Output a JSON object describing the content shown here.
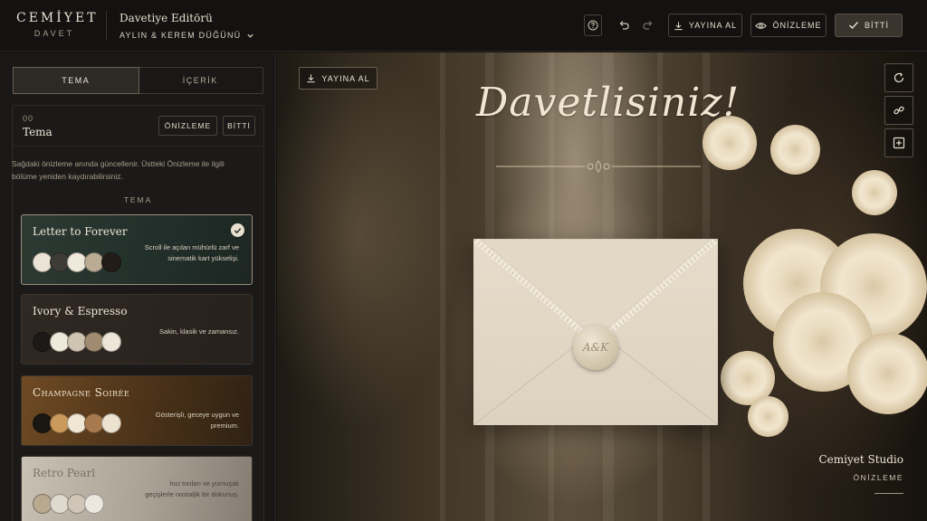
{
  "header": {
    "brand_name": "CEMİYET",
    "brand_sub": "DAVET",
    "title": "Davetiye Editörü",
    "subtitle": "AYLIN & KEREM DÜĞÜNÜ",
    "publish_label": "YAYINA AL",
    "preview_label": "ÖNİZLEME",
    "done_label": "BİTTİ"
  },
  "tabs": [
    {
      "label": "TEMA",
      "active": true
    },
    {
      "label": "İÇERİK",
      "active": false
    }
  ],
  "section": {
    "number": "00",
    "title": "Tema",
    "preview_label": "ÖNİZLEME",
    "done_label": "BİTTİ",
    "description": "Sağdaki önizleme anında güncellenir. Üstteki Önizleme ile ilgili bölüme yeniden kaydırabilirsiniz.",
    "themes_label": "TEMA"
  },
  "themes": [
    {
      "name": "Letter to Forever",
      "description": "Scroll ile açılan mühürlü zarf ve sinematik kart yükselişi.",
      "selected": true,
      "swatches": [
        "#ebe4d6",
        "#3c3b36",
        "#efe9dc",
        "#b9ab94",
        "#221c18"
      ]
    },
    {
      "name": "Ivory & Espresso",
      "description": "Sakin, klasik ve zamansız.",
      "selected": false,
      "swatches": [
        "#1d1916",
        "#efe9dc",
        "#cfc4b2",
        "#a08a70",
        "#ece5d8"
      ]
    },
    {
      "name": "Champagne Soirée",
      "description": "Gösterişli, geceye uygun ve premium.",
      "selected": false,
      "swatches": [
        "#1a1612",
        "#c99a5c",
        "#f0e6d3",
        "#a67a4c",
        "#ebe2d0"
      ]
    },
    {
      "name": "Retro Pearl",
      "description": "İnci tonları ve yumuşak geçişlerle nostaljik bir dokunuş.",
      "selected": false,
      "swatches": [
        "#b8a98f",
        "#e0d9cd",
        "#cfc6b8",
        "#ece7df"
      ]
    }
  ],
  "preview": {
    "publish_label": "YAYINA AL",
    "headline": "Davetlisiniz!",
    "seal_monogram": "A&K",
    "studio_name": "Cemiyet Studio",
    "studio_sub": "ÖNİZLEME"
  },
  "colors": {
    "background": "#131110",
    "panel": "#1a1816",
    "accent": "#e8dfcf",
    "selected_border": "#9a8f7c"
  }
}
